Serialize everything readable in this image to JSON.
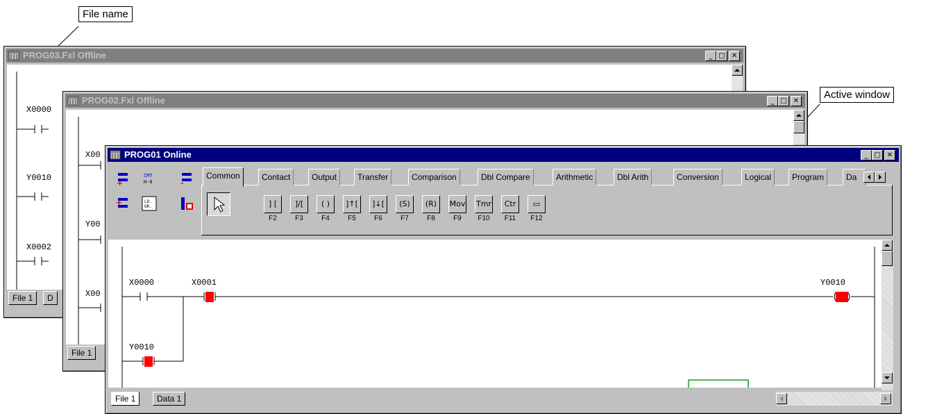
{
  "annotations": {
    "file_name": "File name",
    "active_window": "Active window"
  },
  "windows": {
    "back": {
      "title": "PROG03.Fxl Offline",
      "labels": [
        "X0000",
        "Y0010",
        "X0002"
      ],
      "tabs": [
        "File 1",
        "D"
      ]
    },
    "middle": {
      "title": "PROG02.Fxl Offline",
      "labels": [
        "X00",
        "Y00",
        "X00"
      ],
      "tabs": [
        "File 1"
      ]
    },
    "front": {
      "title": "PROG01 Online",
      "tool_tabs": [
        "Common",
        "Contact",
        "Output",
        "Transfer",
        "Comparison",
        "Dbl Compare",
        "Arithmetic",
        "Dbl Arith",
        "Conversion",
        "Logical",
        "Program",
        "Da"
      ],
      "instructions": [
        {
          "symbol": "] [",
          "key": "F2"
        },
        {
          "symbol": "]/[",
          "key": "F3"
        },
        {
          "symbol": "( )",
          "key": "F4"
        },
        {
          "symbol": "]↑[",
          "key": "F5"
        },
        {
          "symbol": "]↓[",
          "key": "F6"
        },
        {
          "symbol": "(S)",
          "key": "F7"
        },
        {
          "symbol": "(R)",
          "key": "F8"
        },
        {
          "symbol": "Mov",
          "key": "F9"
        },
        {
          "symbol": "Tmr",
          "key": "F10"
        },
        {
          "symbol": "Ctr",
          "key": "F11"
        },
        {
          "symbol": "▭",
          "key": "F12"
        }
      ],
      "ladder": {
        "x0000": "X0000",
        "x0001": "X0001",
        "y0010_out": "Y0010",
        "y0010_contact": "Y0010"
      },
      "tabs": [
        "File 1",
        "Data 1"
      ]
    }
  },
  "colors": {
    "active_title": "#000080",
    "inactive_title": "#808080",
    "energized": "#ff0000",
    "frame_line": "#1c9a1c"
  }
}
